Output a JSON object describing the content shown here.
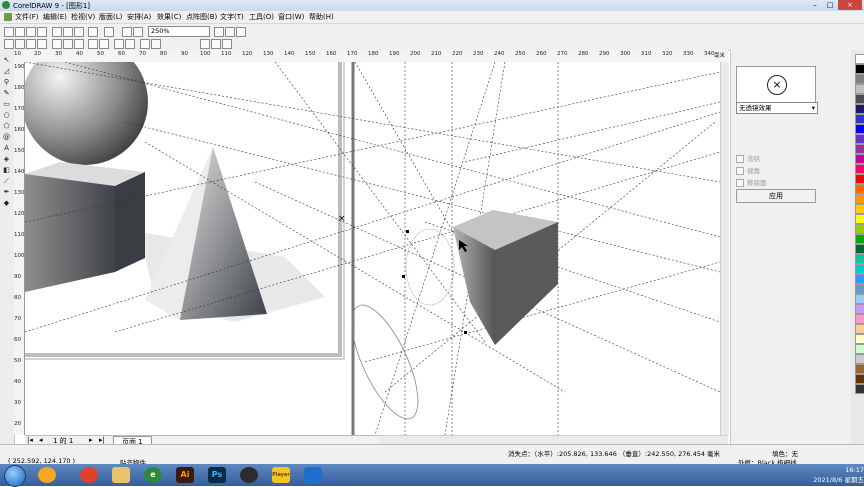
{
  "window": {
    "title": "CorelDRAW 9 - [图形1]",
    "min": "–",
    "max": "□",
    "close": "×"
  },
  "menu": [
    "文件(F)",
    "编辑(E)",
    "检视(V)",
    "版面(L)",
    "安排(A)",
    "效果(C)",
    "点阵图(B)",
    "文字(T)",
    "工具(O)",
    "窗口(W)",
    "帮助(H)"
  ],
  "toolbar": {
    "zoom": "250%"
  },
  "ruler": {
    "h_ticks": [
      "10",
      "20",
      "30",
      "40",
      "50",
      "60",
      "70",
      "80",
      "90",
      "100",
      "110",
      "120",
      "130",
      "140",
      "150",
      "160",
      "170",
      "180",
      "190",
      "200",
      "210",
      "220",
      "230",
      "240",
      "250",
      "260",
      "270",
      "280",
      "290",
      "300",
      "310",
      "320",
      "330",
      "340"
    ],
    "h_unit": "毫米",
    "v_ticks": [
      "190",
      "180",
      "170",
      "160",
      "150",
      "140",
      "130",
      "120",
      "110",
      "100",
      "90",
      "80",
      "70",
      "60",
      "50",
      "40",
      "30",
      "20"
    ]
  },
  "docker": {
    "lens_symbol": "×",
    "lens_type": "无透镜效果",
    "checkboxes": [
      "冻结",
      "视角",
      "移除面"
    ],
    "apply_label": "应用"
  },
  "pages": {
    "nav": "1 的 1",
    "tab": "页面  1"
  },
  "status": {
    "coords": "( 252.592, 124.170 )",
    "snap": "贴齐物件",
    "vanishing": "消失点：（水平）:205.826, 133.646 （垂直）:242.550, 276.454 毫米",
    "fill": "填色：无",
    "outline": "外框：Black  极细线"
  },
  "palette": [
    "#ffffff",
    "#000000",
    "#808080",
    "#c0c0c0",
    "#4d4d4d",
    "#1a1a66",
    "#3333cc",
    "#0000ff",
    "#6633cc",
    "#993399",
    "#cc0099",
    "#ff0066",
    "#ff0000",
    "#ff6600",
    "#ff9900",
    "#ffcc00",
    "#ffff00",
    "#99cc00",
    "#00aa00",
    "#006633",
    "#00cc99",
    "#00cccc",
    "#3399ff",
    "#6699cc",
    "#99ccff",
    "#cc99ff",
    "#ff99cc",
    "#ffcc99",
    "#ffffcc",
    "#ccffcc",
    "#cccccc",
    "#996633",
    "#663300",
    "#333333"
  ],
  "clock": {
    "time": "16:17",
    "date": "2021/8/6 星期五"
  },
  "taskbar": {
    "ai_label": "Ai",
    "ps_label": "Ps",
    "player_label": "Player"
  }
}
